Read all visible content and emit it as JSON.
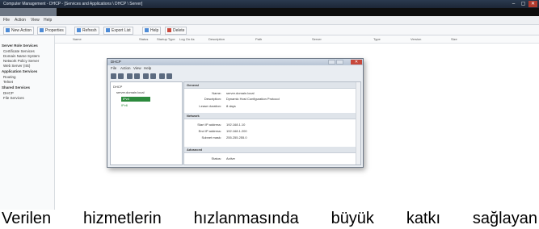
{
  "window": {
    "title": "Computer Management - DHCP - [Services and Applications \\ DHCP \\ Server]",
    "controls": [
      "–",
      "▢",
      "✕"
    ]
  },
  "menu": [
    "File",
    "Action",
    "View",
    "Help"
  ],
  "toolbar": {
    "buttons": [
      "New Action",
      "Properties",
      "Refresh",
      "Export List",
      "Help",
      "Delete"
    ]
  },
  "columns": [
    "Name",
    "Status",
    "Startup Type",
    "Log On As",
    "Description",
    "Path",
    "Server",
    "Type",
    "Version",
    "Size"
  ],
  "nav": {
    "groups": [
      {
        "label": "Server Role Services",
        "items": [
          "Certificate Services",
          "Domain Name System",
          "Network Policy Server",
          "Web Server (IIS)"
        ]
      },
      {
        "label": "Application Services",
        "items": [
          "Routing",
          "Telnet"
        ]
      },
      {
        "label": "Shared Services",
        "items": [
          "DHCP",
          "File Services"
        ]
      }
    ]
  },
  "dialog": {
    "title": "DHCP",
    "close": "✕",
    "menu": [
      "File",
      "Action",
      "View",
      "Help"
    ],
    "tree": {
      "root": "DHCP",
      "server": "server.domain.local",
      "ipv4": "IPv4",
      "ipv6": "IPv6"
    },
    "sections": {
      "general": "General",
      "name_label": "Name:",
      "name_value": "server.domain.local",
      "desc_label": "Description:",
      "desc_value": "Dynamic Host Configuration Protocol",
      "lease_label": "Lease duration:",
      "lease_value": "8 days",
      "network": "Network",
      "start_label": "Start IP address:",
      "start_value": "192.168.1.10",
      "end_label": "End IP address:",
      "end_value": "192.168.1.200",
      "subnet_label": "Subnet mask:",
      "subnet_value": "255.255.255.0",
      "advanced": "Advanced",
      "status_label": "Status:",
      "status_value": "Active"
    }
  },
  "caption": "Verilen hizmetlerin hızlanmasında büyük katkı sağlayan"
}
